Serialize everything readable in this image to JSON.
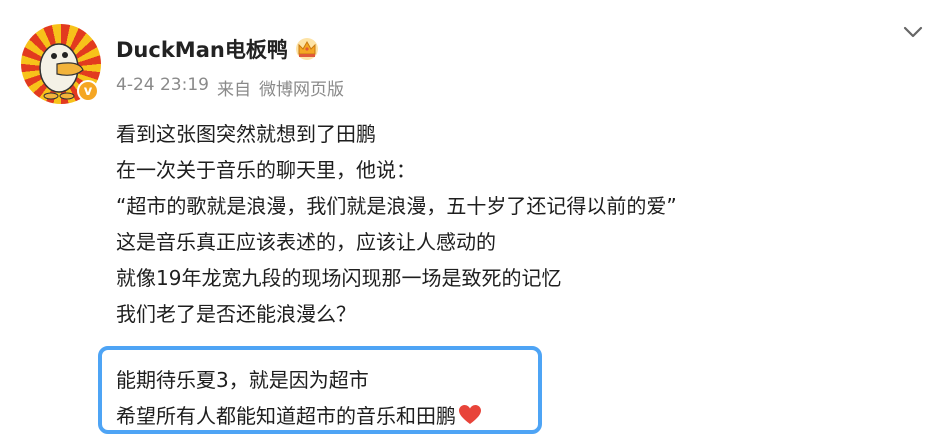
{
  "post": {
    "username": "DuckMan电板鸭",
    "timestamp": "4-24 23:19",
    "source_prefix": "来自",
    "source": "微博网页版",
    "lines": [
      "看到这张图突然就想到了田鹏",
      "在一次关于音乐的聊天里，他说：",
      "“超市的歌就是浪漫，我们就是浪漫，五十岁了还记得以前的爱”",
      "这是音乐真正应该表述的，应该让人感动的",
      "就像19年龙宽九段的现场闪现那一场是致死的记忆",
      "我们老了是否还能浪漫么？"
    ],
    "highlight_lines": [
      "能期待乐夏3，就是因为超市",
      "希望所有人都能知道超市的音乐和田鹏"
    ]
  },
  "colors": {
    "highlight_border": "#4ea4f5",
    "verified_badge": "#f5a623",
    "meta_text": "#8a8a8a"
  },
  "icons": {
    "avatar": "duck-avatar",
    "verified": "verified-badge-icon",
    "crown": "crown-icon",
    "chevron": "chevron-down-icon",
    "heart": "heart-icon"
  }
}
